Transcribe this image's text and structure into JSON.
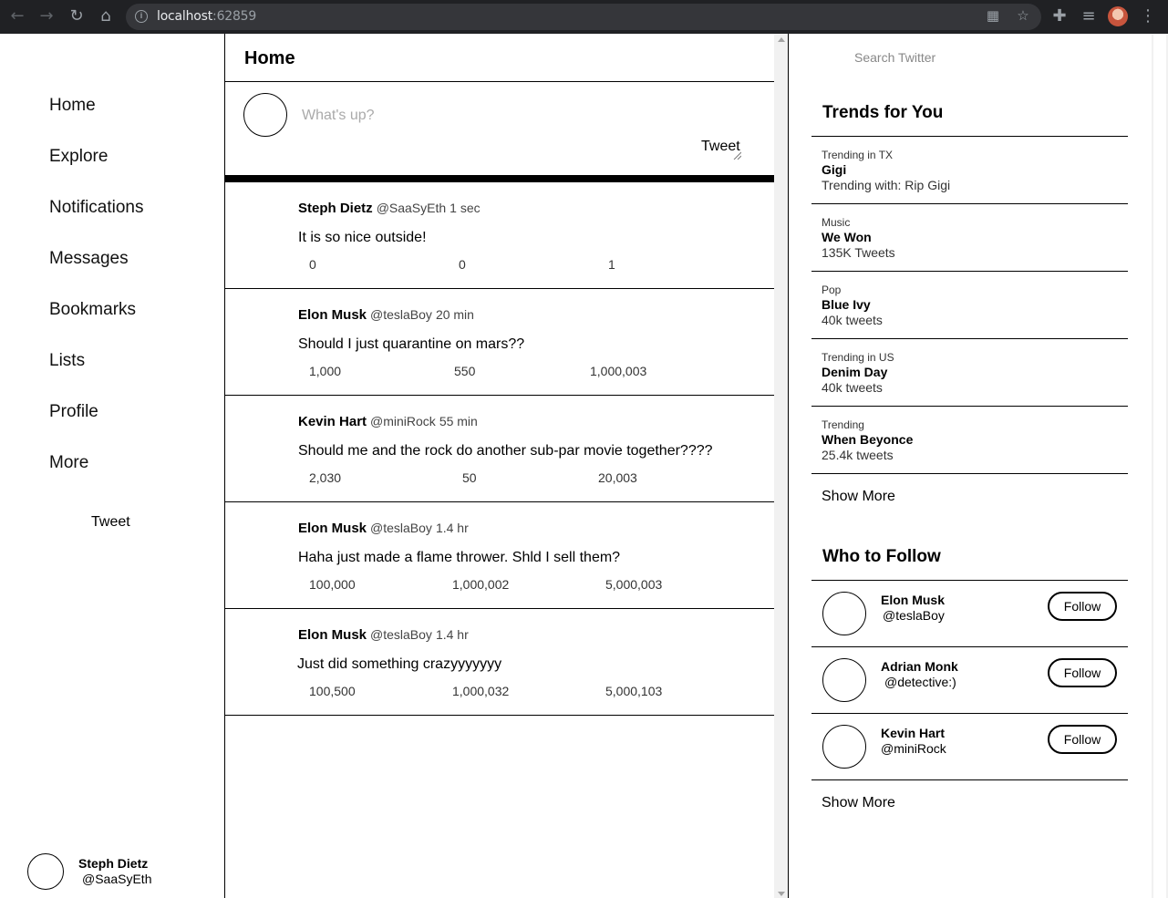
{
  "browser": {
    "url_host": "localhost",
    "url_port": ":62859"
  },
  "sidebar": {
    "items": [
      {
        "label": "Home"
      },
      {
        "label": "Explore"
      },
      {
        "label": "Notifications"
      },
      {
        "label": "Messages"
      },
      {
        "label": "Bookmarks"
      },
      {
        "label": "Lists"
      },
      {
        "label": "Profile"
      },
      {
        "label": "More"
      }
    ],
    "tweet_label": "Tweet",
    "user": {
      "name": "Steph Dietz",
      "handle": "@SaaSyEth"
    }
  },
  "feed": {
    "title": "Home",
    "composer": {
      "placeholder": "What's up?",
      "tweet_label": "Tweet"
    },
    "posts": [
      {
        "name": "Steph Dietz",
        "handle": "@SaaSyEth",
        "time": "1 sec",
        "text": "It is so nice outside!",
        "stats": [
          "0",
          "0",
          "1"
        ]
      },
      {
        "name": "Elon Musk",
        "handle": "@teslaBoy",
        "time": "20 min",
        "text": "Should I just quarantine on mars??",
        "stats": [
          "1,000",
          "550",
          "1,000,003"
        ]
      },
      {
        "name": "Kevin Hart",
        "handle": "@miniRock",
        "time": "55 min",
        "text": "Should me and the rock do another sub-par movie together????",
        "stats": [
          "2,030",
          "50",
          "20,003"
        ]
      },
      {
        "name": "Elon Musk",
        "handle": "@teslaBoy",
        "time": "1.4 hr",
        "text": "Haha just made a flame thrower. Shld I sell them?",
        "stats": [
          "100,000",
          "1,000,002",
          "5,000,003"
        ]
      },
      {
        "name": "Elon Musk",
        "handle": "@teslaBoy",
        "time": "1.4 hr",
        "text": "Just did something crazyyyyyyy",
        "stats": [
          "100,500",
          "1,000,032",
          "5,000,103"
        ]
      }
    ]
  },
  "right": {
    "search_placeholder": "Search Twitter",
    "trends_title": "Trends for You",
    "trends": [
      {
        "category": "Trending in TX",
        "title": "Gigi",
        "sub": "Trending with: Rip Gigi"
      },
      {
        "category": "Music",
        "title": "We Won",
        "sub": "135K Tweets"
      },
      {
        "category": "Pop",
        "title": "Blue Ivy",
        "sub": "40k tweets"
      },
      {
        "category": "Trending in US",
        "title": "Denim Day",
        "sub": "40k tweets"
      },
      {
        "category": "Trending",
        "title": "When Beyonce",
        "sub": "25.4k tweets"
      }
    ],
    "trends_show_more": "Show More",
    "follow_title": "Who to Follow",
    "follow": [
      {
        "name": "Elon Musk",
        "handle": "@teslaBoy",
        "button": "Follow"
      },
      {
        "name": "Adrian Monk",
        "handle": "@detective:)",
        "button": "Follow"
      },
      {
        "name": "Kevin Hart",
        "handle": "@miniRock",
        "button": "Follow"
      }
    ],
    "follow_show_more": "Show More"
  }
}
